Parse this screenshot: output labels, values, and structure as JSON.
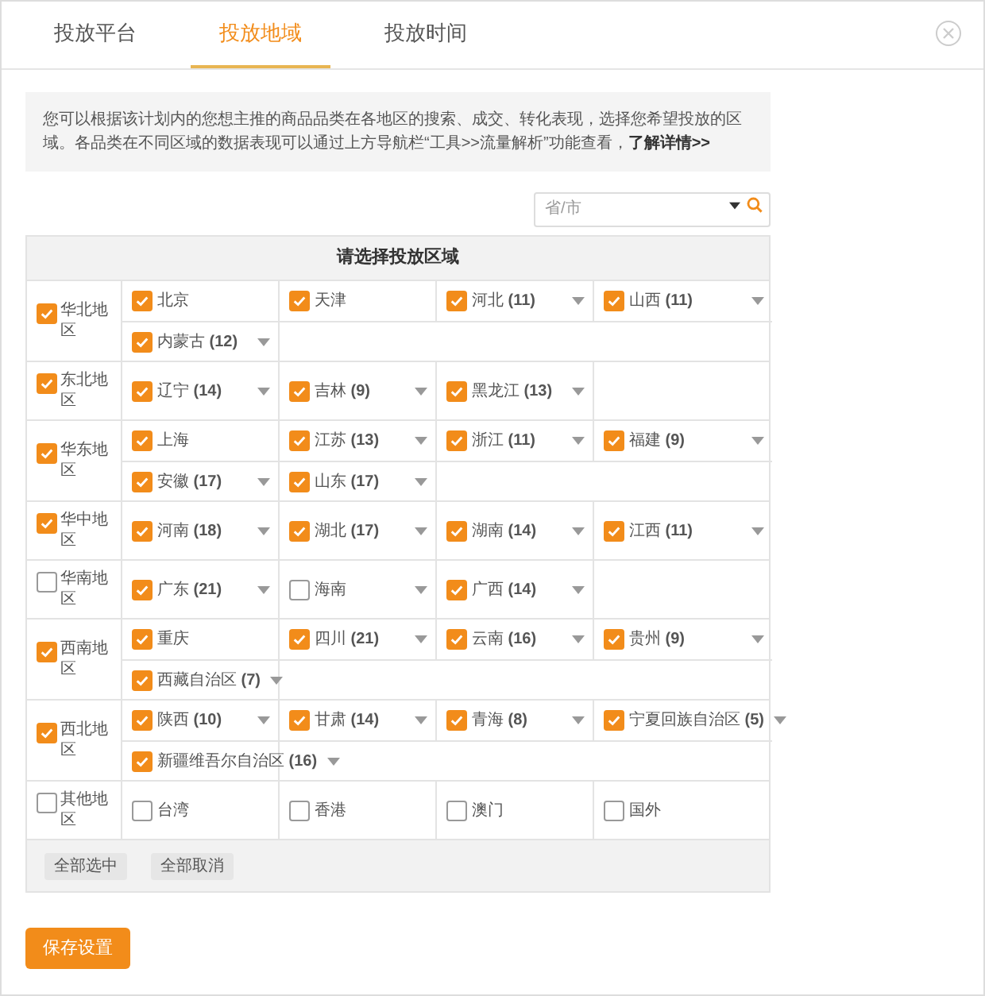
{
  "tabs": [
    {
      "label": "投放平台",
      "selected": false
    },
    {
      "label": "投放地域",
      "selected": true
    },
    {
      "label": "投放时间",
      "selected": false
    }
  ],
  "notice": {
    "text": "您可以根据该计划内的您想主推的商品品类在各地区的搜索、成交、转化表现，选择您希望投放的区域。各品类在不同区域的数据表现可以通过上方导航栏“工具>>流量解析”功能查看，",
    "link": "了解详情>>"
  },
  "search": {
    "placeholder": "省/市"
  },
  "table": {
    "title": "请选择投放区域",
    "regions": [
      {
        "name": "华北地区",
        "checked": true,
        "provinces": [
          {
            "label": "北京",
            "checked": true,
            "expandable": false
          },
          {
            "label": "天津",
            "checked": true,
            "expandable": false
          },
          {
            "label": "河北 **(11)**",
            "checked": true,
            "expandable": true
          },
          {
            "label": "山西 **(11)**",
            "checked": true,
            "expandable": true
          },
          {
            "label": "内蒙古 **(12)**",
            "checked": true,
            "expandable": true
          }
        ]
      },
      {
        "name": "东北地区",
        "checked": true,
        "provinces": [
          {
            "label": "辽宁 **(14)**",
            "checked": true,
            "expandable": true
          },
          {
            "label": "吉林 **(9)**",
            "checked": true,
            "expandable": true
          },
          {
            "label": "黑龙江 **(13)**",
            "checked": true,
            "expandable": true
          }
        ]
      },
      {
        "name": "华东地区",
        "checked": true,
        "provinces": [
          {
            "label": "上海",
            "checked": true,
            "expandable": false
          },
          {
            "label": "江苏 **(13)**",
            "checked": true,
            "expandable": true
          },
          {
            "label": "浙江 **(11)**",
            "checked": true,
            "expandable": true
          },
          {
            "label": "福建 **(9)**",
            "checked": true,
            "expandable": true
          },
          {
            "label": "安徽 **(17)**",
            "checked": true,
            "expandable": true
          },
          {
            "label": "山东 **(17)**",
            "checked": true,
            "expandable": true
          }
        ]
      },
      {
        "name": "华中地区",
        "checked": true,
        "provinces": [
          {
            "label": "河南 **(18)**",
            "checked": true,
            "expandable": true
          },
          {
            "label": "湖北 **(17)**",
            "checked": true,
            "expandable": true
          },
          {
            "label": "湖南 **(14)**",
            "checked": true,
            "expandable": true
          },
          {
            "label": "江西 **(11)**",
            "checked": true,
            "expandable": true
          }
        ]
      },
      {
        "name": "华南地区",
        "checked": false,
        "provinces": [
          {
            "label": "广东 **(21)**",
            "checked": true,
            "expandable": true
          },
          {
            "label": "海南",
            "checked": false,
            "expandable": true
          },
          {
            "label": "广西 **(14)**",
            "checked": true,
            "expandable": true
          }
        ]
      },
      {
        "name": "西南地区",
        "checked": true,
        "provinces": [
          {
            "label": "重庆",
            "checked": true,
            "expandable": false
          },
          {
            "label": "四川 **(21)**",
            "checked": true,
            "expandable": true
          },
          {
            "label": "云南 **(16)**",
            "checked": true,
            "expandable": true
          },
          {
            "label": "贵州 **(9)**",
            "checked": true,
            "expandable": true
          },
          {
            "label": "西藏自治区 **(7)**",
            "checked": true,
            "expandable": true
          }
        ]
      },
      {
        "name": "西北地区",
        "checked": true,
        "provinces": [
          {
            "label": "陕西 **(10)**",
            "checked": true,
            "expandable": true
          },
          {
            "label": "甘肃 **(14)**",
            "checked": true,
            "expandable": true
          },
          {
            "label": "青海 **(8)**",
            "checked": true,
            "expandable": true
          },
          {
            "label": "宁夏回族自治区 **(5)**",
            "checked": true,
            "expandable": true
          },
          {
            "label": "新疆维吾尔自治区 **(16)**",
            "checked": true,
            "expandable": true
          }
        ]
      },
      {
        "name": "其他地区",
        "checked": false,
        "provinces": [
          {
            "label": "台湾",
            "checked": false,
            "expandable": false
          },
          {
            "label": "香港",
            "checked": false,
            "expandable": false
          },
          {
            "label": "澳门",
            "checked": false,
            "expandable": false
          },
          {
            "label": "国外",
            "checked": false,
            "expandable": false
          }
        ]
      }
    ],
    "actions": [
      "全部选中",
      "全部取消"
    ]
  },
  "save_button": "保存设置"
}
